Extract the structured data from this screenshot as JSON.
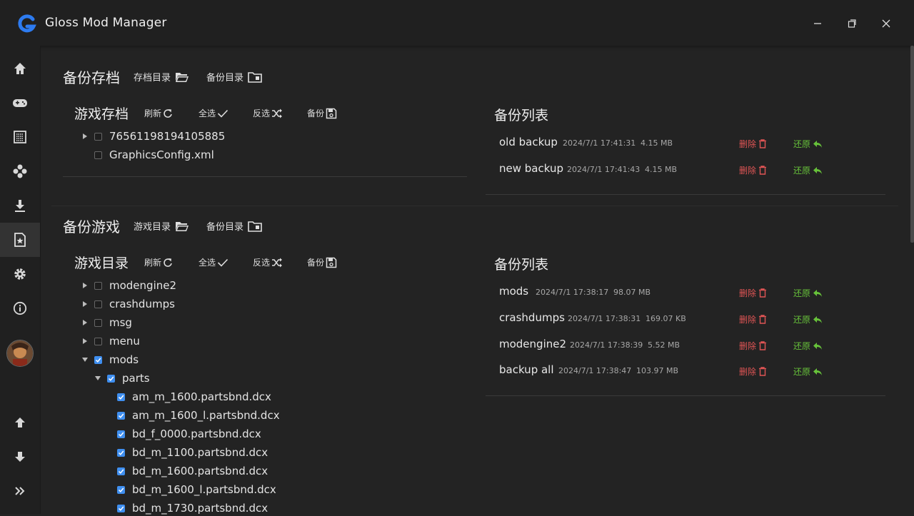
{
  "app": {
    "title": "Gloss Mod Manager"
  },
  "colors": {
    "accent": "#3f8ff0",
    "danger": "#e05555",
    "success": "#67c23a",
    "logo": "#2d7bf0"
  },
  "sidebar": {
    "items": [
      {
        "name": "home-icon"
      },
      {
        "name": "game-icon"
      },
      {
        "name": "grid-icon"
      },
      {
        "name": "mods-icon"
      },
      {
        "name": "download-icon"
      },
      {
        "name": "backup-icon"
      },
      {
        "name": "gear-icon"
      },
      {
        "name": "info-icon"
      }
    ],
    "active": "backup-icon",
    "bottom": [
      {
        "name": "arrow-up-icon"
      },
      {
        "name": "arrow-down-icon"
      },
      {
        "name": "double-chevron-right-icon"
      }
    ]
  },
  "save_section": {
    "title": "备份存档",
    "link_save_dir": "存档目录",
    "link_backup_dir": "备份目录",
    "sub_title": "游戏存档",
    "tools": {
      "refresh": "刷新",
      "select_all": "全选",
      "invert": "反选",
      "backup": "备份"
    },
    "tree": [
      {
        "label": "76561198194105885",
        "expandable": true,
        "checked": false
      },
      {
        "label": "GraphicsConfig.xml",
        "expandable": false,
        "checked": false
      }
    ],
    "backup_list_title": "备份列表",
    "backups": [
      {
        "name": "old backup",
        "date": "2024/7/1 17:41:31",
        "size": "4.15 MB"
      },
      {
        "name": "new backup",
        "date": "2024/7/1 17:41:43",
        "size": "4.15 MB"
      }
    ]
  },
  "game_section": {
    "title": "备份游戏",
    "link_game_dir": "游戏目录",
    "link_backup_dir": "备份目录",
    "sub_title": "游戏目录",
    "tools": {
      "refresh": "刷新",
      "select_all": "全选",
      "invert": "反选",
      "backup": "备份"
    },
    "tree": [
      {
        "label": "modengine2",
        "expandable": true,
        "expanded": false,
        "checked": false,
        "level": 0
      },
      {
        "label": "crashdumps",
        "expandable": true,
        "expanded": false,
        "checked": false,
        "level": 0
      },
      {
        "label": "msg",
        "expandable": true,
        "expanded": false,
        "checked": false,
        "level": 0
      },
      {
        "label": "menu",
        "expandable": true,
        "expanded": false,
        "checked": false,
        "level": 0
      },
      {
        "label": "mods",
        "expandable": true,
        "expanded": true,
        "checked": true,
        "level": 0
      },
      {
        "label": "parts",
        "expandable": true,
        "expanded": true,
        "checked": true,
        "level": 1
      },
      {
        "label": "am_m_1600.partsbnd.dcx",
        "expandable": false,
        "checked": true,
        "level": 2
      },
      {
        "label": "am_m_1600_l.partsbnd.dcx",
        "expandable": false,
        "checked": true,
        "level": 2
      },
      {
        "label": "bd_f_0000.partsbnd.dcx",
        "expandable": false,
        "checked": true,
        "level": 2
      },
      {
        "label": "bd_m_1100.partsbnd.dcx",
        "expandable": false,
        "checked": true,
        "level": 2
      },
      {
        "label": "bd_m_1600.partsbnd.dcx",
        "expandable": false,
        "checked": true,
        "level": 2
      },
      {
        "label": "bd_m_1600_l.partsbnd.dcx",
        "expandable": false,
        "checked": true,
        "level": 2
      },
      {
        "label": "bd_m_1730.partsbnd.dcx",
        "expandable": false,
        "checked": true,
        "level": 2
      }
    ],
    "backup_list_title": "备份列表",
    "backups": [
      {
        "name": "mods",
        "date": "2024/7/1 17:38:17",
        "size": "98.07 MB"
      },
      {
        "name": "crashdumps",
        "date": "2024/7/1 17:38:31",
        "size": "169.07 KB"
      },
      {
        "name": "modengine2",
        "date": "2024/7/1 17:38:39",
        "size": "5.52 MB"
      },
      {
        "name": "backup all",
        "date": "2024/7/1 17:38:47",
        "size": "103.97 MB"
      }
    ]
  },
  "actions": {
    "delete": "删除",
    "restore": "还原"
  }
}
